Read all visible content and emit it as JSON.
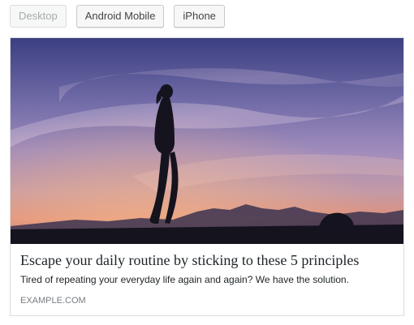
{
  "preview_tabs": [
    {
      "label": "Desktop",
      "disabled": true
    },
    {
      "label": "Android Mobile",
      "disabled": false
    },
    {
      "label": "iPhone",
      "disabled": false
    }
  ],
  "card": {
    "image_icon": "sunset-silhouette-photo",
    "title": "Escape your daily routine by sticking to these 5 principles",
    "description": "Tired of repeating your everyday life again and again? We have the solution.",
    "domain": "EXAMPLE.COM"
  },
  "colors": {
    "sky_top": "#4a4e8c",
    "sky_mid": "#9a84b8",
    "sky_horizon": "#d98a76",
    "silhouette": "#15131e"
  }
}
